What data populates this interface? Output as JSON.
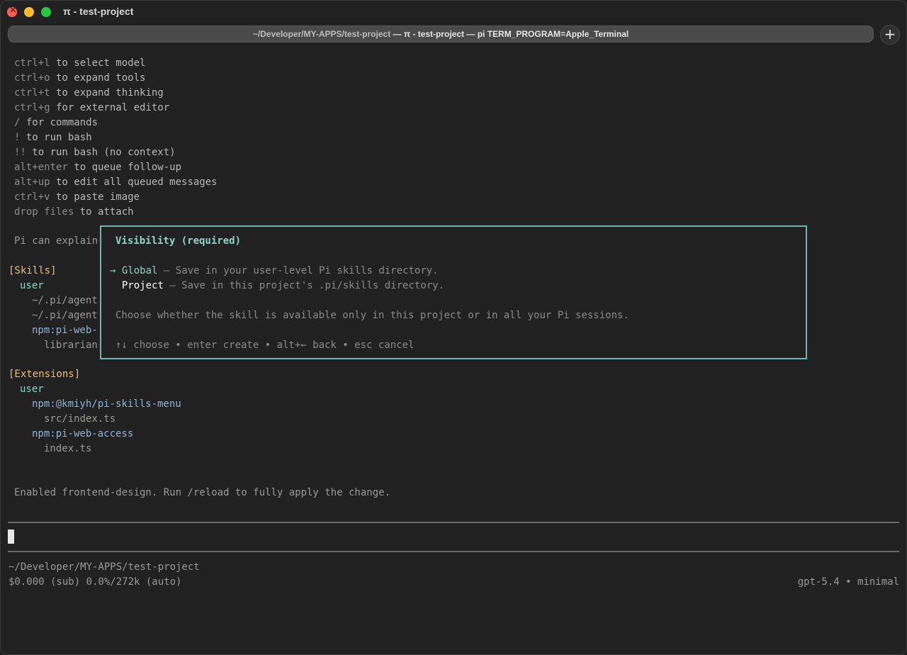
{
  "window": {
    "title": "π - test-project",
    "tab": {
      "path": "~/Developer/MY-APPS/test-project",
      "sep": " — ",
      "rest": "π - test-project — pi TERM_PROGRAM=Apple_Terminal"
    },
    "new_tab_symbol": "+"
  },
  "shortcuts": [
    {
      "key": "ctrl+l",
      "desc": " to select model"
    },
    {
      "key": "ctrl+o",
      "desc": " to expand tools"
    },
    {
      "key": "ctrl+t",
      "desc": " to expand thinking"
    },
    {
      "key": "ctrl+g",
      "desc": " for external editor"
    },
    {
      "key": "/",
      "desc": " for commands"
    },
    {
      "key": "!",
      "desc": " to run bash"
    },
    {
      "key": "!!",
      "desc": " to run bash (no context)"
    },
    {
      "key": "alt+enter",
      "desc": " to queue follow-up"
    },
    {
      "key": "alt+up",
      "desc": " to edit all queued messages"
    },
    {
      "key": "ctrl+v",
      "desc": " to paste image"
    },
    {
      "key": "drop files",
      "desc": " to attach"
    }
  ],
  "intro_partial": "Pi can explain",
  "skills": {
    "heading": "[Skills]",
    "scope": "user",
    "items": [
      "~/.pi/agent",
      "~/.pi/agent"
    ],
    "package": "npm:pi-web-",
    "package_item": "librarian"
  },
  "extensions": {
    "heading": "[Extensions]",
    "scope": "user",
    "packages": [
      {
        "name": "npm:@kmiyh/pi-skills-menu",
        "file": "src/index.ts"
      },
      {
        "name": "npm:pi-web-access",
        "file": "index.ts"
      }
    ]
  },
  "modal": {
    "title": "Visibility (required)",
    "options": [
      {
        "arrow": "→",
        "label": "Global",
        "desc": " — Save in your user-level Pi skills directory."
      },
      {
        "arrow": " ",
        "label": "Project",
        "desc": " — Save in this project's .pi/skills directory."
      }
    ],
    "help": "Choose whether the skill is available only in this project or in all your Pi sessions.",
    "hints": "↑↓ choose • enter create • alt+← back • esc cancel"
  },
  "status_message": "Enabled frontend-design. Run /reload to fully apply the change.",
  "footer": {
    "cwd": "~/Developer/MY-APPS/test-project",
    "usage": "$0.000 (sub) 0.0%/272k (auto)",
    "model": "gpt-5.4 • minimal"
  }
}
